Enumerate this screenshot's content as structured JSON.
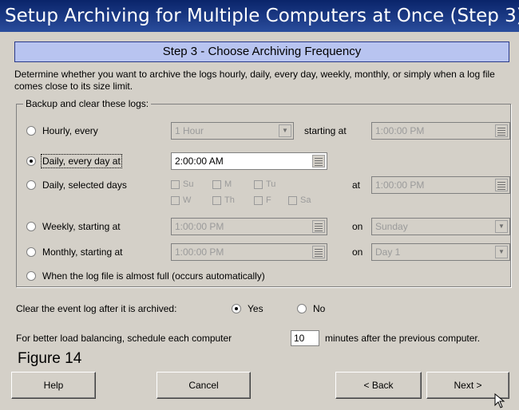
{
  "window": {
    "title": "Setup Archiving for Multiple Computers at Once (Step 3)"
  },
  "step_title": "Step 3 - Choose Archiving Frequency",
  "description": "Determine whether you want to archive the logs hourly, daily, every day, weekly, monthly, or simply when a log file comes close to its size limit.",
  "group": {
    "legend": "Backup and clear these logs:",
    "hourly": {
      "label": "Hourly, every",
      "interval": "1 Hour",
      "starting_label": "starting at",
      "starting_value": "1:00:00 PM"
    },
    "daily_every": {
      "label": "Daily, every day at",
      "time": "2:00:00 AM",
      "selected": true
    },
    "daily_selected": {
      "label": "Daily, selected days",
      "days": [
        "Su",
        "M",
        "Tu",
        "W",
        "Th",
        "F",
        "Sa"
      ],
      "at_label": "at",
      "at_value": "1:00:00 PM"
    },
    "weekly": {
      "label": "Weekly, starting at",
      "time": "1:00:00 PM",
      "on_label": "on",
      "on_value": "Sunday"
    },
    "monthly": {
      "label": "Monthly, starting at",
      "time": "1:00:00 PM",
      "on_label": "on",
      "on_value": "Day 1"
    },
    "full": {
      "label": "When the log file is almost full (occurs automatically)"
    }
  },
  "clear_log": {
    "label": "Clear the event log after it is archived:",
    "yes": "Yes",
    "no": "No",
    "selected": "Yes"
  },
  "balancing": {
    "prefix": "For better load balancing, schedule each computer",
    "minutes": "10",
    "suffix": "minutes after the previous computer."
  },
  "figure_caption": "Figure 14",
  "buttons": {
    "help": "Help",
    "cancel": "Cancel",
    "back": "< Back",
    "next": "Next >"
  }
}
